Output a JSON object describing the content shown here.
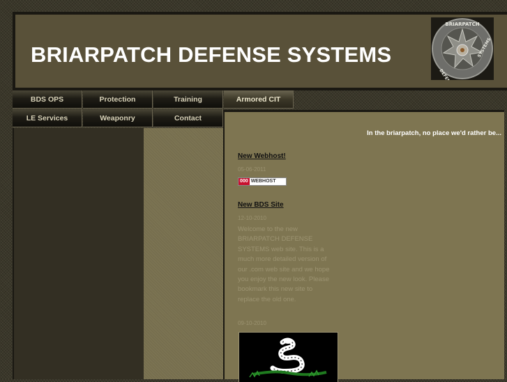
{
  "site": {
    "title": "BRIARPATCH DEFENSE SYSTEMS",
    "tagline": "In the briarpatch, no place we'd rather be...",
    "logo_top_text": "BRIARPATCH",
    "logo_left_text": "DEFENSE",
    "logo_right_text": "SYSTEMS"
  },
  "nav": {
    "row1": [
      "BDS OPS",
      "Protection",
      "Training",
      "Armored CIT"
    ],
    "row2": [
      "LE Services",
      "Weaponry",
      "Contact"
    ]
  },
  "posts": [
    {
      "title": "New Webhost!",
      "date": "05-06-2011",
      "badge_left": "000",
      "badge_right": "WEBHOST"
    },
    {
      "title": "New BDS Site",
      "date": "12-10-2010",
      "body": "Welcome to the new BRIARPATCH DEFENSE SYSTEMS web site. This is a much more detailed version of our .com web site and we hope you enjoy the new look. Please bookmark this new site to replace the old one."
    },
    {
      "date": "09-10-2010"
    }
  ],
  "colors": {
    "header_bg": "#595139",
    "content_bg": "#7e7551",
    "nav_bg": "#1f1d16",
    "accent_red": "#c8102e"
  },
  "icons": [
    "briarpatch-logo-icon",
    "webhost-badge-icon",
    "gadsden-flag-icon"
  ]
}
